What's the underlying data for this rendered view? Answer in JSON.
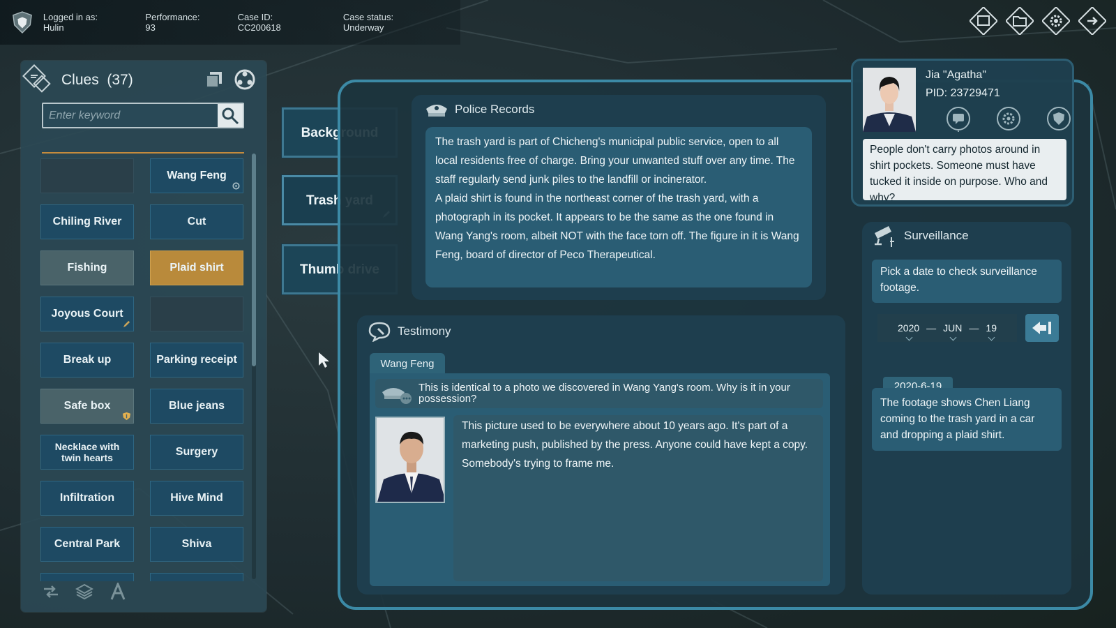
{
  "topbar": {
    "logged_in": "Logged in as: Hulin",
    "performance": "Performance: 93",
    "case_id": "Case ID: CC200618",
    "case_status": "Case status: Underway"
  },
  "top_icons": [
    "window-icon",
    "folder-icon",
    "gear-icon",
    "exit-icon"
  ],
  "clues": {
    "title": "Clues",
    "count": "(37)",
    "search_placeholder": "Enter keyword",
    "items": [
      {
        "label": "",
        "style": "empty"
      },
      {
        "label": "Wang Feng",
        "style": "blue",
        "mark": "gear"
      },
      {
        "label": "Chiling River",
        "style": "blue"
      },
      {
        "label": "Cut",
        "style": "blue"
      },
      {
        "label": "Fishing",
        "style": "grey"
      },
      {
        "label": "Plaid shirt",
        "style": "orange"
      },
      {
        "label": "Joyous Court",
        "style": "blue",
        "mark": "pen"
      },
      {
        "label": "",
        "style": "empty"
      },
      {
        "label": "Break up",
        "style": "blue"
      },
      {
        "label": "Parking receipt",
        "style": "blue"
      },
      {
        "label": "Safe box",
        "style": "grey",
        "mark": "shield"
      },
      {
        "label": "Blue jeans",
        "style": "blue"
      },
      {
        "label": "Necklace with twin hearts",
        "style": "blue",
        "small": true
      },
      {
        "label": "Surgery",
        "style": "blue"
      },
      {
        "label": "Infiltration",
        "style": "blue"
      },
      {
        "label": "Hive Mind",
        "style": "blue"
      },
      {
        "label": "Central Park",
        "style": "blue"
      },
      {
        "label": "Shiva",
        "style": "blue"
      }
    ]
  },
  "categories": [
    "Background",
    "Trash yard",
    "Thumb drive"
  ],
  "police_records": {
    "title": "Police Records",
    "p1": "The trash yard is part of Chicheng's municipal public service, open to all local residents free of charge. Bring your unwanted stuff over any time. The staff regularly send junk piles to the landfill or incinerator.",
    "p2": "A plaid shirt is found in the northeast corner of the trash yard, with a photograph in its pocket. It appears to be the same as the one found in Wang Yang's room, albeit NOT with the face torn off. The figure in it is Wang Feng, board of director of Peco Therapeutical."
  },
  "testimony": {
    "title": "Testimony",
    "tab": "Wang Feng",
    "question": "This is identical to a photo we discovered in Wang Yang's room. Why is it in your possession?",
    "answer": "This picture used to be everywhere about 10 years ago. It's part of a marketing push, published by the press. Anyone could have kept a copy. Somebody's trying to frame me."
  },
  "profile": {
    "name": "Jia \"Agatha\"",
    "pid": "PID: 23729471",
    "note": "People don't carry photos around in shirt pockets. Someone must have tucked it inside on purpose. Who and why?"
  },
  "surveillance": {
    "title": "Surveillance",
    "hint": "Pick a date to check surveillance footage.",
    "year": "2020",
    "month": "JUN",
    "day": "19",
    "sep": "—",
    "result_date": "2020-6-19",
    "result": "The footage shows Chen Liang coming to the trash yard in a car and dropping a plaid shirt."
  },
  "colors": {
    "accent_blue": "#3c8aa6",
    "clue_orange": "#b98a3b",
    "clue_blue": "#1e4a63",
    "clue_grey": "#4a6369"
  }
}
